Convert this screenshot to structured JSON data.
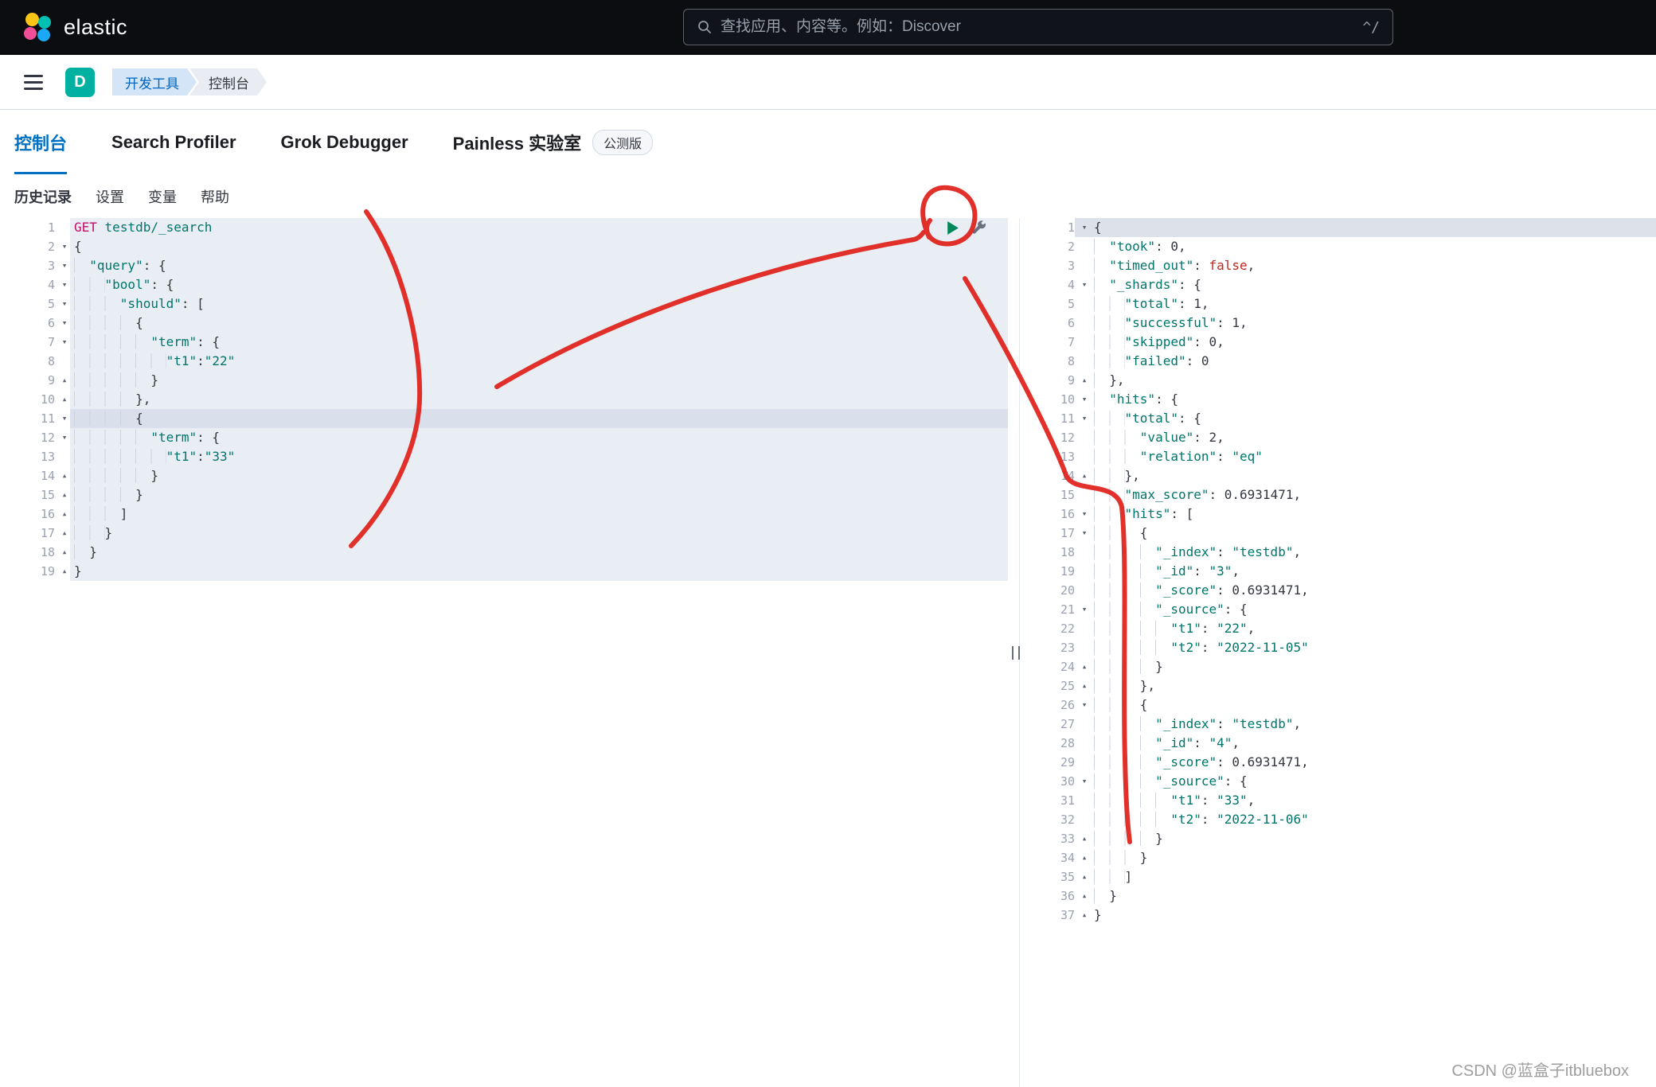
{
  "header": {
    "brand": "elastic",
    "search_placeholder": "查找应用、内容等。例如：Discover",
    "search_shortcut": "^/"
  },
  "nav": {
    "space_initial": "D",
    "breadcrumbs": [
      "开发工具",
      "控制台"
    ]
  },
  "tabs": [
    {
      "label": "控制台",
      "active": true
    },
    {
      "label": "Search Profiler",
      "active": false
    },
    {
      "label": "Grok Debugger",
      "active": false
    },
    {
      "label": "Painless 实验室",
      "active": false,
      "badge": "公测版"
    }
  ],
  "toolbar": [
    "历史记录",
    "设置",
    "变量",
    "帮助"
  ],
  "colors": {
    "accent_blue": "#0071c2",
    "space_badge_teal": "#00b0a0",
    "code_string_teal": "#00756b",
    "code_method_magenta": "#c80a68",
    "code_boolean_red": "#bd271e",
    "annotation_red": "#e0201a",
    "editor_tint": "#e9edf4"
  },
  "editor": {
    "request": {
      "active_line": 11,
      "lines": [
        {
          "f": "",
          "t": "GET testdb/_search"
        },
        {
          "f": "d",
          "t": "{"
        },
        {
          "f": "d",
          "t": "  \"query\": {"
        },
        {
          "f": "d",
          "t": "    \"bool\": {"
        },
        {
          "f": "d",
          "t": "      \"should\": ["
        },
        {
          "f": "d",
          "t": "        {"
        },
        {
          "f": "d",
          "t": "          \"term\": {"
        },
        {
          "f": "",
          "t": "            \"t1\":\"22\""
        },
        {
          "f": "u",
          "t": "          }"
        },
        {
          "f": "u",
          "t": "        },"
        },
        {
          "f": "d",
          "t": "        {"
        },
        {
          "f": "d",
          "t": "          \"term\": {"
        },
        {
          "f": "",
          "t": "            \"t1\":\"33\""
        },
        {
          "f": "u",
          "t": "          }"
        },
        {
          "f": "u",
          "t": "        }"
        },
        {
          "f": "u",
          "t": "      ]"
        },
        {
          "f": "u",
          "t": "    }"
        },
        {
          "f": "u",
          "t": "  }"
        },
        {
          "f": "u",
          "t": "}"
        }
      ]
    },
    "response": {
      "active_line": 1,
      "lines": [
        {
          "f": "d",
          "t": "{"
        },
        {
          "f": "",
          "t": "  \"took\": 0,"
        },
        {
          "f": "",
          "t": "  \"timed_out\": false,"
        },
        {
          "f": "d",
          "t": "  \"_shards\": {"
        },
        {
          "f": "",
          "t": "    \"total\": 1,"
        },
        {
          "f": "",
          "t": "    \"successful\": 1,"
        },
        {
          "f": "",
          "t": "    \"skipped\": 0,"
        },
        {
          "f": "",
          "t": "    \"failed\": 0"
        },
        {
          "f": "u",
          "t": "  },"
        },
        {
          "f": "d",
          "t": "  \"hits\": {"
        },
        {
          "f": "d",
          "t": "    \"total\": {"
        },
        {
          "f": "",
          "t": "      \"value\": 2,"
        },
        {
          "f": "",
          "t": "      \"relation\": \"eq\""
        },
        {
          "f": "u",
          "t": "    },"
        },
        {
          "f": "",
          "t": "    \"max_score\": 0.6931471,"
        },
        {
          "f": "d",
          "t": "    \"hits\": ["
        },
        {
          "f": "d",
          "t": "      {"
        },
        {
          "f": "",
          "t": "        \"_index\": \"testdb\","
        },
        {
          "f": "",
          "t": "        \"_id\": \"3\","
        },
        {
          "f": "",
          "t": "        \"_score\": 0.6931471,"
        },
        {
          "f": "d",
          "t": "        \"_source\": {"
        },
        {
          "f": "",
          "t": "          \"t1\": \"22\","
        },
        {
          "f": "",
          "t": "          \"t2\": \"2022-11-05\""
        },
        {
          "f": "u",
          "t": "        }"
        },
        {
          "f": "u",
          "t": "      },"
        },
        {
          "f": "d",
          "t": "      {"
        },
        {
          "f": "",
          "t": "        \"_index\": \"testdb\","
        },
        {
          "f": "",
          "t": "        \"_id\": \"4\","
        },
        {
          "f": "",
          "t": "        \"_score\": 0.6931471,"
        },
        {
          "f": "d",
          "t": "        \"_source\": {"
        },
        {
          "f": "",
          "t": "          \"t1\": \"33\","
        },
        {
          "f": "",
          "t": "          \"t2\": \"2022-11-06\""
        },
        {
          "f": "u",
          "t": "        }"
        },
        {
          "f": "u",
          "t": "      }"
        },
        {
          "f": "u",
          "t": "    ]"
        },
        {
          "f": "u",
          "t": "  }"
        },
        {
          "f": "u",
          "t": "}"
        }
      ]
    }
  },
  "watermark": "CSDN @蓝盒子itbluebox"
}
